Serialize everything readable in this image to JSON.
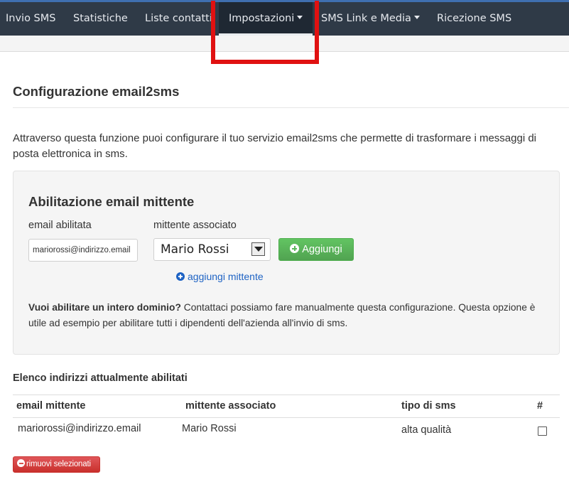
{
  "nav": {
    "items": [
      {
        "label": "Invio SMS",
        "dropdown": false
      },
      {
        "label": "Statistiche",
        "dropdown": false
      },
      {
        "label": "Liste contatti",
        "dropdown": false
      },
      {
        "label": "Impostazioni",
        "dropdown": true,
        "active": true
      },
      {
        "label": "SMS Link e Media",
        "dropdown": true
      },
      {
        "label": "Ricezione SMS",
        "dropdown": false
      }
    ]
  },
  "page": {
    "title": "Configurazione email2sms",
    "intro": "Attraverso questa funzione puoi configurare il tuo servizio email2sms che permette di trasformare i messaggi di posta elettronica in sms."
  },
  "enable_form": {
    "heading": "Abilitazione email mittente",
    "email_label": "email abilitata",
    "email_value": "mariorossi@indirizzo.email",
    "sender_label": "mittente associato",
    "sender_selected": "Mario Rossi",
    "add_button": "Aggiungi",
    "add_sender_link": "aggiungi mittente",
    "domain_note_bold": "Vuoi abilitare un intero dominio?",
    "domain_note_text": " Contattaci possiamo fare manualmente questa configurazione. Questa opzione è utile ad esempio per abilitare tutti i dipendenti dell'azienda all'invio di sms."
  },
  "list": {
    "title": "Elenco indirizzi attualmente abilitati",
    "headers": [
      "email mittente",
      "mittente associato",
      "tipo di sms",
      "#"
    ],
    "rows": [
      {
        "email": "mariorossi@indirizzo.email",
        "sender": "Mario Rossi",
        "type": "alta qualità",
        "checked": false
      }
    ],
    "remove_button": "rimuovi selezionati"
  },
  "colors": {
    "navbar": "#2f3a47",
    "highlight": "#e01111",
    "success": "#5cb85c",
    "danger": "#d9534f",
    "link": "#1e63c4"
  }
}
